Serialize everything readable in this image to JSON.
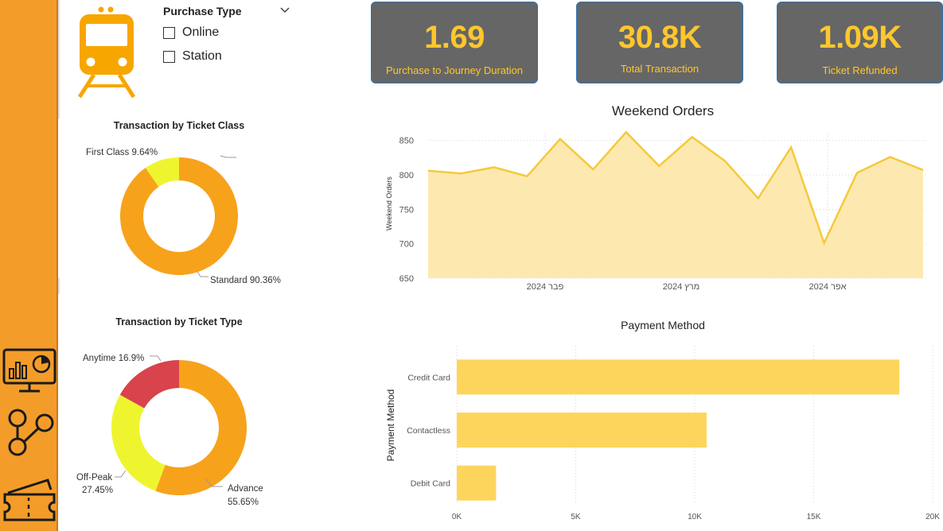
{
  "slicer": {
    "title": "Purchase Type",
    "items": [
      {
        "label": "Online",
        "checked": false
      },
      {
        "label": "Station",
        "checked": false
      }
    ]
  },
  "nav": {
    "icons": [
      "dashboard-icon",
      "network-icon",
      "ticket-icon"
    ]
  },
  "kpis": [
    {
      "value": "1.69",
      "label": "Purchase to Journey Duration"
    },
    {
      "value": "30.8K",
      "label": "Total Transaction"
    },
    {
      "value": "1.09K",
      "label": "Ticket Refunded"
    }
  ],
  "colors": {
    "sidebar": "#f39c2a",
    "kpi_bg": "#666666",
    "kpi_text": "#ffc72c",
    "orange": "#f7a21b",
    "yellow": "#eef52f",
    "red": "#d9434b",
    "line": "#f5c93b",
    "area": "#fde9b0",
    "bar": "#fdd55c"
  },
  "chart_data": [
    {
      "type": "pie",
      "title": "Transaction by Ticket Class",
      "slices": [
        {
          "name": "First Class",
          "value": 9.64,
          "label": "First Class 9.64%"
        },
        {
          "name": "Standard",
          "value": 90.36,
          "label": "Standard 90.36%"
        }
      ]
    },
    {
      "type": "pie",
      "title": "Transaction by Ticket Type",
      "slices": [
        {
          "name": "Advance",
          "value": 55.65,
          "label": "Advance",
          "pct": "55.65%"
        },
        {
          "name": "Off-Peak",
          "value": 27.45,
          "label": "Off-Peak",
          "pct": "27.45%"
        },
        {
          "name": "Anytime",
          "value": 16.9,
          "label": "Anytime 16.9%"
        }
      ]
    },
    {
      "type": "area",
      "title": "Weekend Orders",
      "ylabel": "Weekend Orders",
      "ylim": [
        650,
        860
      ],
      "yticks": [
        650,
        700,
        750,
        800,
        850
      ],
      "xtick_labels": [
        "2024 פבר",
        "2024 מרץ",
        "2024 אפר"
      ],
      "values": [
        806,
        802,
        811,
        798,
        852,
        808,
        862,
        813,
        855,
        820,
        766,
        840,
        701,
        803,
        826,
        807
      ],
      "grid": true
    },
    {
      "type": "bar",
      "orientation": "horizontal",
      "title": "Payment Method",
      "ylabel": "Payment Method",
      "categories": [
        "Credit Card",
        "Contactless",
        "Debit Card"
      ],
      "values": [
        18600,
        10500,
        1650
      ],
      "xlim": [
        0,
        20000
      ],
      "xtick_labels": [
        "0K",
        "5K",
        "10K",
        "15K",
        "20K"
      ],
      "grid": true
    }
  ]
}
